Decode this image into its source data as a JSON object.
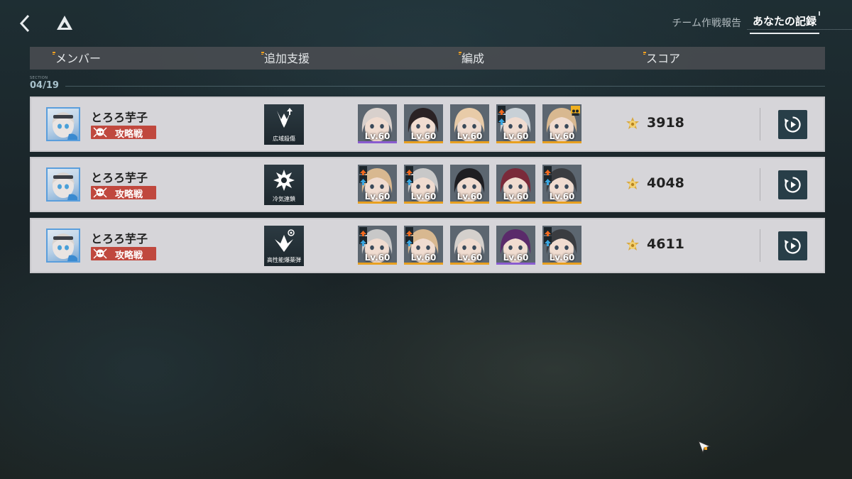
{
  "tabs": [
    {
      "label": "チーム作戦報告",
      "active": false
    },
    {
      "label": "あなたの記録",
      "active": true
    }
  ],
  "header": {
    "member": "メンバー",
    "support": "追加支援",
    "formation": "編成",
    "score": "スコア"
  },
  "section": {
    "label": "SECTION",
    "date": "04/19"
  },
  "accent_color": "#f0a020",
  "records": [
    {
      "player_name": "とろろ芋子",
      "mode_label": "攻略戦",
      "support_label": "広域殺傷",
      "support_icon": "wide-area-kill-icon",
      "score": "3918",
      "characters": [
        {
          "level": "Lv.60",
          "rarity": "#8a5cd0",
          "hair": "#d8d0cc",
          "upgrade": false,
          "team": false
        },
        {
          "level": "Lv.60",
          "rarity": "#e8a020",
          "hair": "#2a2224",
          "upgrade": false,
          "team": false
        },
        {
          "level": "Lv.60",
          "rarity": "#e8a020",
          "hair": "#e8cba8",
          "upgrade": false,
          "team": false
        },
        {
          "level": "Lv.60",
          "rarity": "#e8a020",
          "hair": "#c8d0d6",
          "upgrade": true,
          "team": false
        },
        {
          "level": "Lv.60",
          "rarity": "#e8a020",
          "hair": "#d8b890",
          "upgrade": false,
          "team": true
        }
      ]
    },
    {
      "player_name": "とろろ芋子",
      "mode_label": "攻略戦",
      "support_label": "冷気連鎖",
      "support_icon": "frost-chain-icon",
      "score": "4048",
      "characters": [
        {
          "level": "Lv.60",
          "rarity": "#e8a020",
          "hair": "#d8b890",
          "upgrade": true,
          "team": false
        },
        {
          "level": "Lv.60",
          "rarity": "#e8a020",
          "hair": "#c8c8c8",
          "upgrade": true,
          "team": false
        },
        {
          "level": "Lv.60",
          "rarity": "#e8a020",
          "hair": "#1e1e22",
          "upgrade": false,
          "team": false
        },
        {
          "level": "Lv.60",
          "rarity": "#e8a020",
          "hair": "#7a2a3a",
          "upgrade": false,
          "team": false
        },
        {
          "level": "Lv.60",
          "rarity": "#e8a020",
          "hair": "#3a3c40",
          "upgrade": true,
          "team": false
        }
      ]
    },
    {
      "player_name": "とろろ芋子",
      "mode_label": "攻略戦",
      "support_label": "高性能爆薬弾",
      "support_icon": "high-explosive-icon",
      "score": "4611",
      "characters": [
        {
          "level": "Lv.60",
          "rarity": "#e8a020",
          "hair": "#c8c8c8",
          "upgrade": true,
          "team": false
        },
        {
          "level": "Lv.60",
          "rarity": "#e8a020",
          "hair": "#d8b890",
          "upgrade": true,
          "team": false
        },
        {
          "level": "Lv.60",
          "rarity": "#e8a020",
          "hair": "#d4d0cc",
          "upgrade": false,
          "team": false
        },
        {
          "level": "Lv.60",
          "rarity": "#8a5cd0",
          "hair": "#5a2a6a",
          "upgrade": false,
          "team": false
        },
        {
          "level": "Lv.60",
          "rarity": "#e8a020",
          "hair": "#3a3c40",
          "upgrade": true,
          "team": false
        }
      ]
    }
  ]
}
